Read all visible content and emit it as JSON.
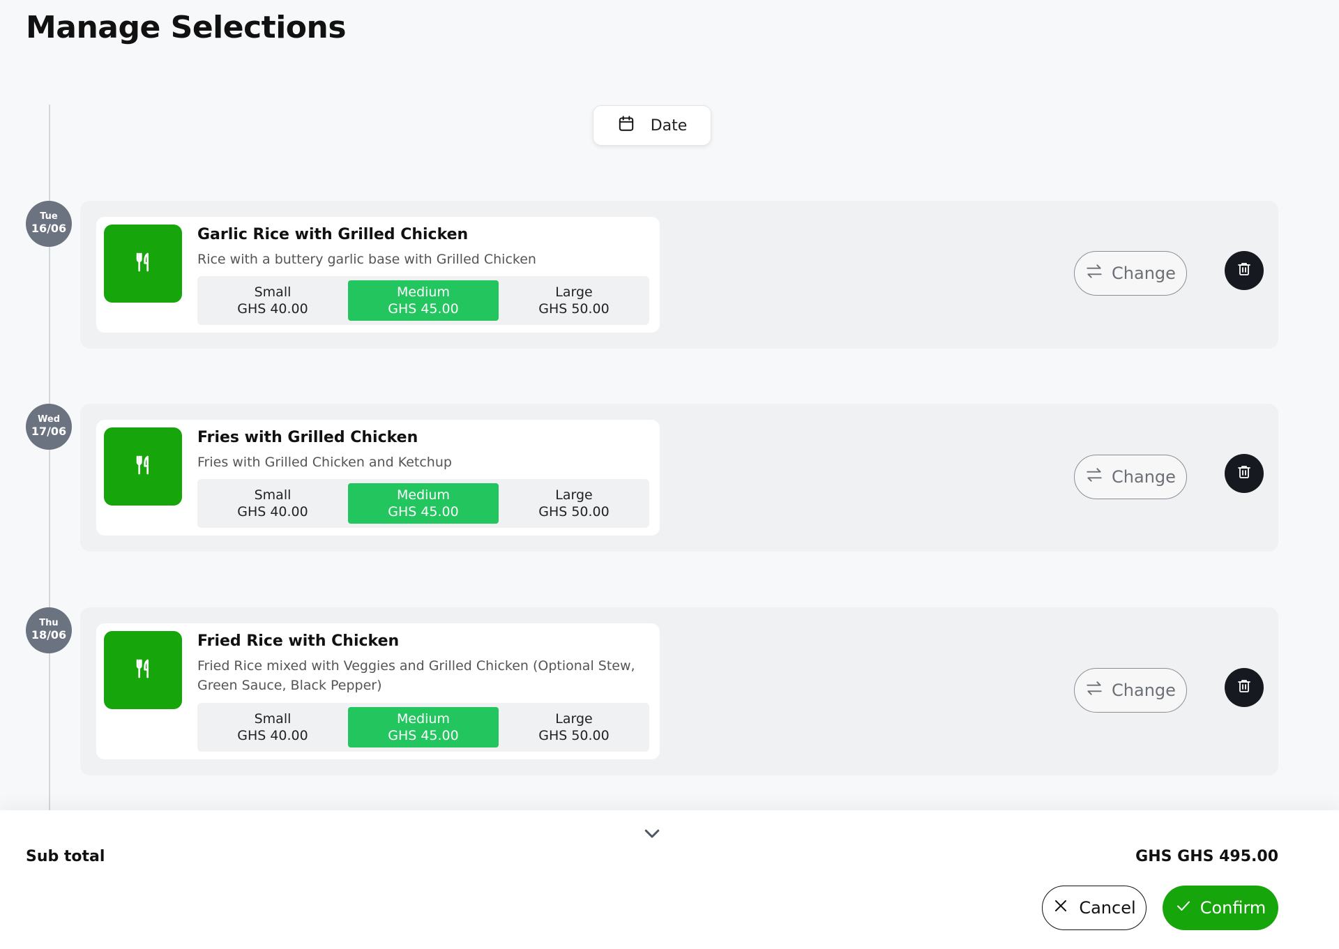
{
  "page": {
    "title": "Manage Selections"
  },
  "filter": {
    "date_label": "Date"
  },
  "colors": {
    "accent": "#17a50c",
    "active_size": "#22c55e",
    "badge": "#6b7280"
  },
  "selections": [
    {
      "day": "Tue",
      "date": "16/06",
      "name": "Garlic Rice with Grilled Chicken",
      "description": "Rice with a buttery garlic base with Grilled Chicken",
      "sizes": [
        {
          "label": "Small",
          "price": "GHS 40.00"
        },
        {
          "label": "Medium",
          "price": "GHS 45.00"
        },
        {
          "label": "Large",
          "price": "GHS 50.00"
        }
      ],
      "selected_size": "Medium",
      "change_label": "Change"
    },
    {
      "day": "Wed",
      "date": "17/06",
      "name": "Fries with Grilled Chicken",
      "description": "Fries with Grilled Chicken and Ketchup",
      "sizes": [
        {
          "label": "Small",
          "price": "GHS 40.00"
        },
        {
          "label": "Medium",
          "price": "GHS 45.00"
        },
        {
          "label": "Large",
          "price": "GHS 50.00"
        }
      ],
      "selected_size": "Medium",
      "change_label": "Change"
    },
    {
      "day": "Thu",
      "date": "18/06",
      "name": "Fried Rice with Chicken",
      "description": "Fried Rice mixed with Veggies and Grilled Chicken (Optional Stew, Green Sauce, Black Pepper)",
      "sizes": [
        {
          "label": "Small",
          "price": "GHS 40.00"
        },
        {
          "label": "Medium",
          "price": "GHS 45.00"
        },
        {
          "label": "Large",
          "price": "GHS 50.00"
        }
      ],
      "selected_size": "Medium",
      "change_label": "Change"
    }
  ],
  "footer": {
    "subtotal_label": "Sub total",
    "subtotal_value": "GHS GHS 495.00",
    "cancel_label": "Cancel",
    "confirm_label": "Confirm"
  }
}
